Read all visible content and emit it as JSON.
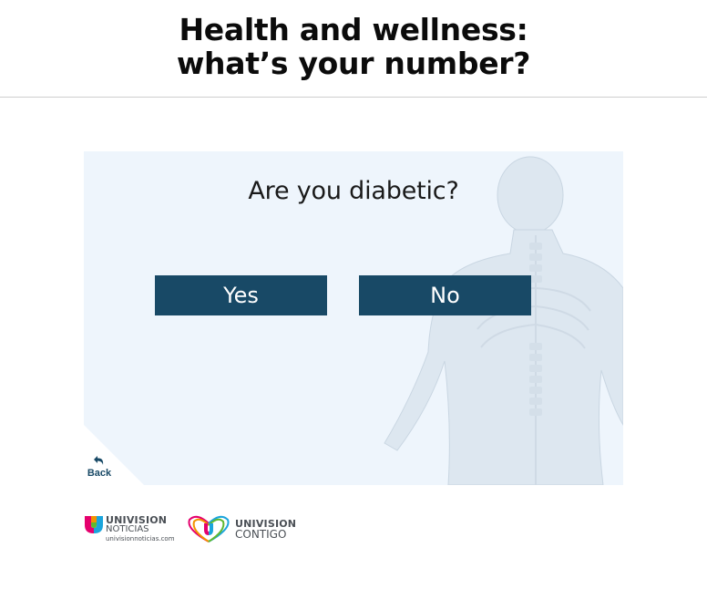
{
  "header": {
    "title_line1": "Health and wellness:",
    "title_line2": "what’s your number?"
  },
  "quiz": {
    "question": "Are you diabetic?",
    "yes_label": "Yes",
    "no_label": "No",
    "back_label": "Back"
  },
  "logos": {
    "noticias_brand": "UNIVISION",
    "noticias_sub": "NOTICIAS",
    "noticias_url": "univisionnoticias.com",
    "contigo_brand": "UNIVISION",
    "contigo_sub": "CONTIGO"
  },
  "colors": {
    "button_bg": "#184966",
    "panel_bg": "#eef5fc",
    "title_color": "#0b0b0b"
  },
  "icons": {
    "back": "back-arrow-icon",
    "body_graphic": "human-skeleton-icon"
  }
}
